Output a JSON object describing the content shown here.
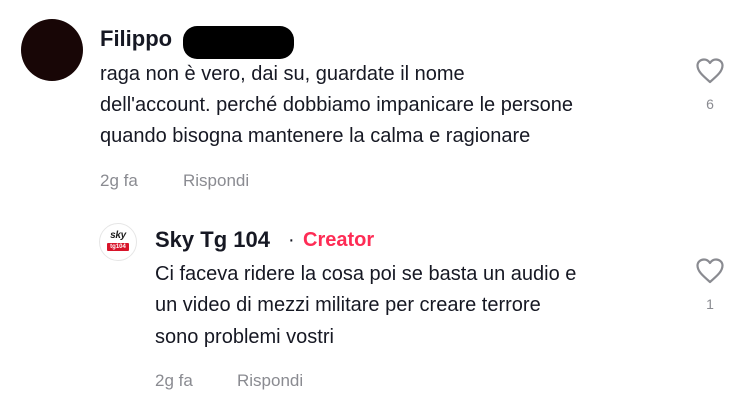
{
  "comments": [
    {
      "author": "Filippo",
      "lines": [
        "raga non è vero, dai su, guardate il nome",
        "dell'account. perché dobbiamo impanicare le persone",
        "quando bisogna mantenere la calma e ragionare"
      ],
      "time": "2g fa",
      "reply_label": "Rispondi",
      "likes": "6",
      "like_icon": "heart-outline-icon"
    },
    {
      "author": "Sky Tg 104",
      "separator": "·",
      "badge": "Creator",
      "avatar_logo_text": "sky",
      "avatar_logo_sub": "tg104",
      "lines": [
        "Ci faceva ridere la cosa poi se basta un audio e",
        "un video di mezzi militare per creare terrore",
        "sono problemi vostri"
      ],
      "time": "2g fa",
      "reply_label": "Rispondi",
      "likes": "1",
      "like_icon": "heart-outline-icon"
    }
  ],
  "colors": {
    "creator_badge": "#fe2c55",
    "meta_text": "#8a8b91",
    "primary_text": "#161823"
  }
}
